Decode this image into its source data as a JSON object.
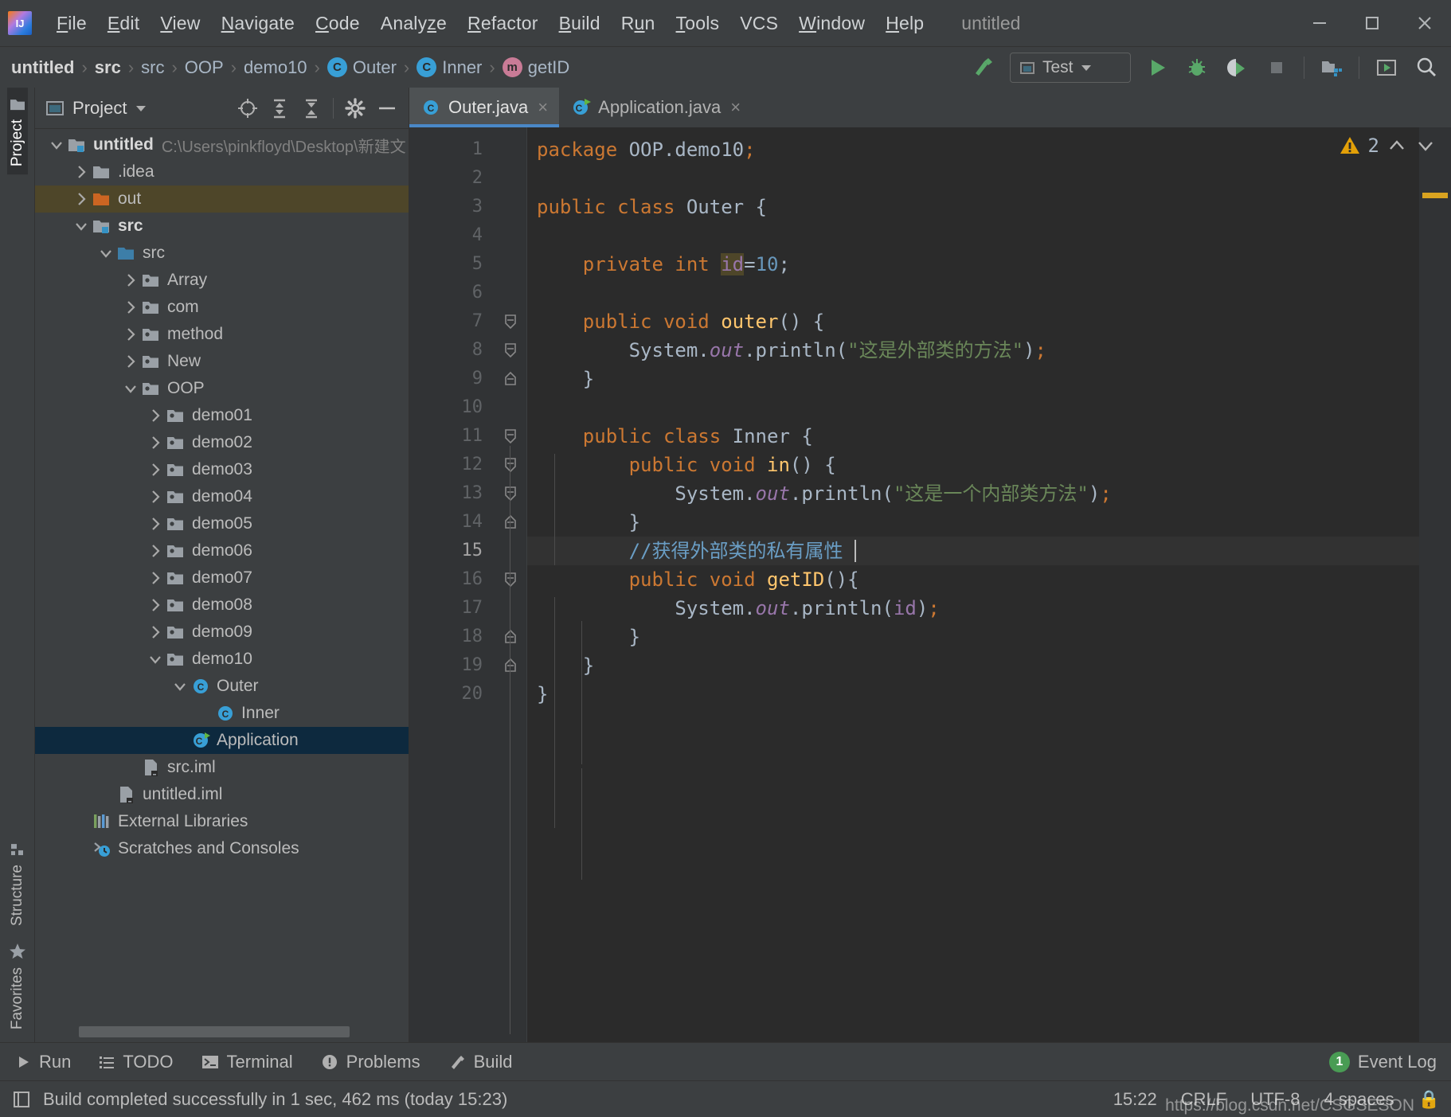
{
  "window": {
    "title": "untitled",
    "logo_text": "IJ",
    "controls": [
      "minimize",
      "maximize",
      "close"
    ]
  },
  "menu": [
    {
      "label": "File",
      "mnemonic": "F"
    },
    {
      "label": "Edit",
      "mnemonic": "E"
    },
    {
      "label": "View",
      "mnemonic": "V"
    },
    {
      "label": "Navigate",
      "mnemonic": "N"
    },
    {
      "label": "Code",
      "mnemonic": "C"
    },
    {
      "label": "Analyze",
      "mnemonic": "z"
    },
    {
      "label": "Refactor",
      "mnemonic": "R"
    },
    {
      "label": "Build",
      "mnemonic": "B"
    },
    {
      "label": "Run",
      "mnemonic": "u"
    },
    {
      "label": "Tools",
      "mnemonic": "T"
    },
    {
      "label": "VCS",
      "mnemonic": ""
    },
    {
      "label": "Window",
      "mnemonic": "W"
    },
    {
      "label": "Help",
      "mnemonic": "H"
    }
  ],
  "breadcrumb": [
    {
      "label": "untitled",
      "bold": true,
      "icon": ""
    },
    {
      "label": "src",
      "bold": true,
      "icon": ""
    },
    {
      "label": "src",
      "bold": false,
      "icon": ""
    },
    {
      "label": "OOP",
      "bold": false,
      "icon": ""
    },
    {
      "label": "demo10",
      "bold": false,
      "icon": ""
    },
    {
      "label": "Outer",
      "bold": false,
      "icon": "class-badge"
    },
    {
      "label": "Inner",
      "bold": false,
      "icon": "class-badge"
    },
    {
      "label": "getID",
      "bold": false,
      "icon": "method-badge"
    }
  ],
  "toolbar": {
    "build_icon": "hammer-icon",
    "run_config": {
      "label": "Test",
      "icon": "run-config-icon",
      "chevron": "chevron-down-icon"
    },
    "run_label": "Run",
    "debug_label": "Debug",
    "run_coverage_label": "Run with Coverage",
    "stop_label": "Stop",
    "project_structure_label": "Project Structure",
    "updates_label": "Updates",
    "search_label": "Search Everywhere"
  },
  "left_strip": {
    "top": [
      {
        "label": "Project",
        "active": true
      }
    ],
    "bottom": [
      {
        "label": "Structure",
        "active": false
      },
      {
        "label": "Favorites",
        "active": false
      }
    ]
  },
  "project_panel": {
    "title": "Project",
    "chevron": "chevron-down-icon",
    "actions": [
      "locate-icon",
      "expand-all-icon",
      "collapse-all-icon",
      "settings-gear-icon",
      "hide-icon"
    ]
  },
  "tree": [
    {
      "label": "untitled",
      "path": "C:\\Users\\pinkfloyd\\Desktop\\新建文",
      "depth": 0,
      "twist": "down",
      "icon": "module-folder",
      "bold": true,
      "state": "none"
    },
    {
      "label": ".idea",
      "path": "",
      "depth": 1,
      "twist": "right",
      "icon": "folder-grey",
      "bold": false,
      "state": "none"
    },
    {
      "label": "out",
      "path": "",
      "depth": 1,
      "twist": "right",
      "icon": "folder-orange",
      "bold": false,
      "state": "olive"
    },
    {
      "label": "src",
      "path": "",
      "depth": 1,
      "twist": "down",
      "icon": "module-folder",
      "bold": true,
      "state": "none"
    },
    {
      "label": "src",
      "path": "",
      "depth": 2,
      "twist": "down",
      "icon": "folder-blue",
      "bold": false,
      "state": "none"
    },
    {
      "label": "Array",
      "path": "",
      "depth": 3,
      "twist": "right",
      "icon": "package",
      "bold": false,
      "state": "none"
    },
    {
      "label": "com",
      "path": "",
      "depth": 3,
      "twist": "right",
      "icon": "package",
      "bold": false,
      "state": "none"
    },
    {
      "label": "method",
      "path": "",
      "depth": 3,
      "twist": "right",
      "icon": "package",
      "bold": false,
      "state": "none"
    },
    {
      "label": "New",
      "path": "",
      "depth": 3,
      "twist": "right",
      "icon": "package",
      "bold": false,
      "state": "none"
    },
    {
      "label": "OOP",
      "path": "",
      "depth": 3,
      "twist": "down",
      "icon": "package",
      "bold": false,
      "state": "none"
    },
    {
      "label": "demo01",
      "path": "",
      "depth": 4,
      "twist": "right",
      "icon": "package",
      "bold": false,
      "state": "none"
    },
    {
      "label": "demo02",
      "path": "",
      "depth": 4,
      "twist": "right",
      "icon": "package",
      "bold": false,
      "state": "none"
    },
    {
      "label": "demo03",
      "path": "",
      "depth": 4,
      "twist": "right",
      "icon": "package",
      "bold": false,
      "state": "none"
    },
    {
      "label": "demo04",
      "path": "",
      "depth": 4,
      "twist": "right",
      "icon": "package",
      "bold": false,
      "state": "none"
    },
    {
      "label": "demo05",
      "path": "",
      "depth": 4,
      "twist": "right",
      "icon": "package",
      "bold": false,
      "state": "none"
    },
    {
      "label": "demo06",
      "path": "",
      "depth": 4,
      "twist": "right",
      "icon": "package",
      "bold": false,
      "state": "none"
    },
    {
      "label": "demo07",
      "path": "",
      "depth": 4,
      "twist": "right",
      "icon": "package",
      "bold": false,
      "state": "none"
    },
    {
      "label": "demo08",
      "path": "",
      "depth": 4,
      "twist": "right",
      "icon": "package",
      "bold": false,
      "state": "none"
    },
    {
      "label": "demo09",
      "path": "",
      "depth": 4,
      "twist": "right",
      "icon": "package",
      "bold": false,
      "state": "none"
    },
    {
      "label": "demo10",
      "path": "",
      "depth": 4,
      "twist": "down",
      "icon": "package",
      "bold": false,
      "state": "none"
    },
    {
      "label": "Outer",
      "path": "",
      "depth": 5,
      "twist": "down",
      "icon": "class",
      "bold": false,
      "state": "none"
    },
    {
      "label": "Inner",
      "path": "",
      "depth": 6,
      "twist": "none",
      "icon": "class",
      "bold": false,
      "state": "none"
    },
    {
      "label": "Application",
      "path": "",
      "depth": 5,
      "twist": "none",
      "icon": "runnable-class",
      "bold": false,
      "state": "blue"
    },
    {
      "label": "src.iml",
      "path": "",
      "depth": 3,
      "twist": "none",
      "icon": "iml-file",
      "bold": false,
      "state": "none"
    },
    {
      "label": "untitled.iml",
      "path": "",
      "depth": 2,
      "twist": "none",
      "icon": "iml-file",
      "bold": false,
      "state": "none"
    },
    {
      "label": "External Libraries",
      "path": "",
      "depth": 1,
      "twist": "none",
      "icon": "libraries",
      "bold": false,
      "state": "none"
    },
    {
      "label": "Scratches and Consoles",
      "path": "",
      "depth": 1,
      "twist": "none",
      "icon": "scratches",
      "bold": false,
      "state": "none"
    }
  ],
  "editor": {
    "tabs": [
      {
        "label": "Outer.java",
        "icon": "class-badge",
        "active": true,
        "close": "×"
      },
      {
        "label": "Application.java",
        "icon": "runnable-class-badge",
        "active": false,
        "close": "×"
      }
    ],
    "warning_count": "2",
    "warning_icon": "warning-triangle-icon",
    "nav_up_icon": "chevron-up-icon",
    "nav_down_icon": "chevron-down-icon",
    "line_numbers": [
      "1",
      "2",
      "3",
      "4",
      "5",
      "6",
      "7",
      "8",
      "9",
      "10",
      "11",
      "12",
      "13",
      "14",
      "15",
      "16",
      "17",
      "18",
      "19",
      "20"
    ],
    "current_line": 15,
    "code_lines": [
      {
        "n": 1,
        "tokens": [
          {
            "t": "package",
            "c": "kw"
          },
          {
            "t": " ",
            "c": "punct"
          },
          {
            "t": "OOP.demo10",
            "c": "cls"
          },
          {
            "t": ";",
            "c": "semi"
          }
        ]
      },
      {
        "n": 2,
        "tokens": []
      },
      {
        "n": 3,
        "tokens": [
          {
            "t": "public",
            "c": "kw"
          },
          {
            "t": " ",
            "c": "punct"
          },
          {
            "t": "class",
            "c": "kw"
          },
          {
            "t": " ",
            "c": "punct"
          },
          {
            "t": "Outer",
            "c": "cls"
          },
          {
            "t": " {",
            "c": "punct"
          }
        ]
      },
      {
        "n": 4,
        "tokens": []
      },
      {
        "n": 5,
        "tokens": [
          {
            "t": "    ",
            "c": "punct"
          },
          {
            "t": "private",
            "c": "kw"
          },
          {
            "t": " ",
            "c": "punct"
          },
          {
            "t": "int",
            "c": "kw"
          },
          {
            "t": " ",
            "c": "punct"
          },
          {
            "t": "id",
            "c": "fld fldbg"
          },
          {
            "t": "=",
            "c": "punct"
          },
          {
            "t": "10",
            "c": "num"
          },
          {
            "t": ";",
            "c": "punct"
          }
        ]
      },
      {
        "n": 6,
        "tokens": []
      },
      {
        "n": 7,
        "tokens": [
          {
            "t": "    ",
            "c": "punct"
          },
          {
            "t": "public",
            "c": "kw"
          },
          {
            "t": " ",
            "c": "punct"
          },
          {
            "t": "void",
            "c": "kw"
          },
          {
            "t": " ",
            "c": "punct"
          },
          {
            "t": "outer",
            "c": "mth"
          },
          {
            "t": "() {",
            "c": "punct"
          }
        ]
      },
      {
        "n": 8,
        "tokens": [
          {
            "t": "        ",
            "c": "punct"
          },
          {
            "t": "System",
            "c": "cls"
          },
          {
            "t": ".",
            "c": "punct"
          },
          {
            "t": "out",
            "c": "stat"
          },
          {
            "t": ".println(",
            "c": "punct"
          },
          {
            "t": "\"这是外部类的方法\"",
            "c": "str"
          },
          {
            "t": ")",
            "c": "punct"
          },
          {
            "t": ";",
            "c": "semi"
          }
        ]
      },
      {
        "n": 9,
        "tokens": [
          {
            "t": "    }",
            "c": "punct"
          }
        ]
      },
      {
        "n": 10,
        "tokens": []
      },
      {
        "n": 11,
        "tokens": [
          {
            "t": "    ",
            "c": "punct"
          },
          {
            "t": "public",
            "c": "kw"
          },
          {
            "t": " ",
            "c": "punct"
          },
          {
            "t": "class",
            "c": "kw"
          },
          {
            "t": " ",
            "c": "punct"
          },
          {
            "t": "Inner",
            "c": "cls"
          },
          {
            "t": " {",
            "c": "punct"
          }
        ]
      },
      {
        "n": 12,
        "tokens": [
          {
            "t": "        ",
            "c": "punct"
          },
          {
            "t": "public",
            "c": "kw"
          },
          {
            "t": " ",
            "c": "punct"
          },
          {
            "t": "void",
            "c": "kw"
          },
          {
            "t": " ",
            "c": "punct"
          },
          {
            "t": "in",
            "c": "mth"
          },
          {
            "t": "() {",
            "c": "punct"
          }
        ]
      },
      {
        "n": 13,
        "tokens": [
          {
            "t": "            ",
            "c": "punct"
          },
          {
            "t": "System",
            "c": "cls"
          },
          {
            "t": ".",
            "c": "punct"
          },
          {
            "t": "out",
            "c": "stat"
          },
          {
            "t": ".println(",
            "c": "punct"
          },
          {
            "t": "\"这是一个内部类方法\"",
            "c": "str"
          },
          {
            "t": ")",
            "c": "punct"
          },
          {
            "t": ";",
            "c": "semi"
          }
        ]
      },
      {
        "n": 14,
        "tokens": [
          {
            "t": "        }",
            "c": "punct"
          }
        ]
      },
      {
        "n": 15,
        "tokens": [
          {
            "t": "        ",
            "c": "punct"
          },
          {
            "t": "//获得外部类的私有属性 ",
            "c": "cmt-doc"
          }
        ],
        "caret": true
      },
      {
        "n": 16,
        "tokens": [
          {
            "t": "        ",
            "c": "punct"
          },
          {
            "t": "public",
            "c": "kw"
          },
          {
            "t": " ",
            "c": "punct"
          },
          {
            "t": "void",
            "c": "kw"
          },
          {
            "t": " ",
            "c": "punct"
          },
          {
            "t": "getID",
            "c": "mth"
          },
          {
            "t": "(){",
            "c": "punct"
          }
        ]
      },
      {
        "n": 17,
        "tokens": [
          {
            "t": "            ",
            "c": "punct"
          },
          {
            "t": "System",
            "c": "cls"
          },
          {
            "t": ".",
            "c": "punct"
          },
          {
            "t": "out",
            "c": "stat"
          },
          {
            "t": ".println(",
            "c": "punct"
          },
          {
            "t": "id",
            "c": "fld"
          },
          {
            "t": ")",
            "c": "punct"
          },
          {
            "t": ";",
            "c": "semi"
          }
        ]
      },
      {
        "n": 18,
        "tokens": [
          {
            "t": "        }",
            "c": "punct"
          }
        ]
      },
      {
        "n": 19,
        "tokens": [
          {
            "t": "    }",
            "c": "punct"
          }
        ]
      },
      {
        "n": 20,
        "tokens": [
          {
            "t": "}",
            "c": "punct"
          }
        ]
      }
    ]
  },
  "bottom_bar": {
    "items": [
      {
        "label": "Run",
        "icon": "play-icon"
      },
      {
        "label": "TODO",
        "icon": "todo-list-icon"
      },
      {
        "label": "Terminal",
        "icon": "terminal-icon"
      },
      {
        "label": "Problems",
        "icon": "problems-icon"
      },
      {
        "label": "Build",
        "icon": "hammer-icon"
      }
    ],
    "event_log": {
      "label": "Event Log",
      "count": "1"
    }
  },
  "status_bar": {
    "icon": "toggle-sidebar-icon",
    "message": "Build completed successfully in 1 sec, 462 ms (today 15:23)",
    "cells": [
      {
        "name": "caret-position",
        "value": "15:22"
      },
      {
        "name": "line-separator",
        "value": "CRLF"
      },
      {
        "name": "file-encoding",
        "value": "UTF-8"
      },
      {
        "name": "indent",
        "value": "4 spaces"
      },
      {
        "name": "lock",
        "value": "🔒"
      }
    ],
    "watermark": "https://blog.csdn.net/CSGSESON"
  },
  "colors": {
    "accent_blue": "#4a88c7",
    "selection_blue": "#0d293e",
    "selection_olive": "#4e4629",
    "keyword": "#cc7832",
    "string": "#6a8759",
    "number": "#6897bb",
    "method": "#ffc66d",
    "field": "#9876aa",
    "comment_doc": "#6a9ec5",
    "warning": "#d9a320",
    "run_green": "#499c54",
    "class_badge": "#389fd6",
    "method_badge": "#c97b96",
    "panel_bg": "#3c3f41",
    "editor_bg": "#2b2b2b",
    "gutter_bg": "#313335"
  }
}
